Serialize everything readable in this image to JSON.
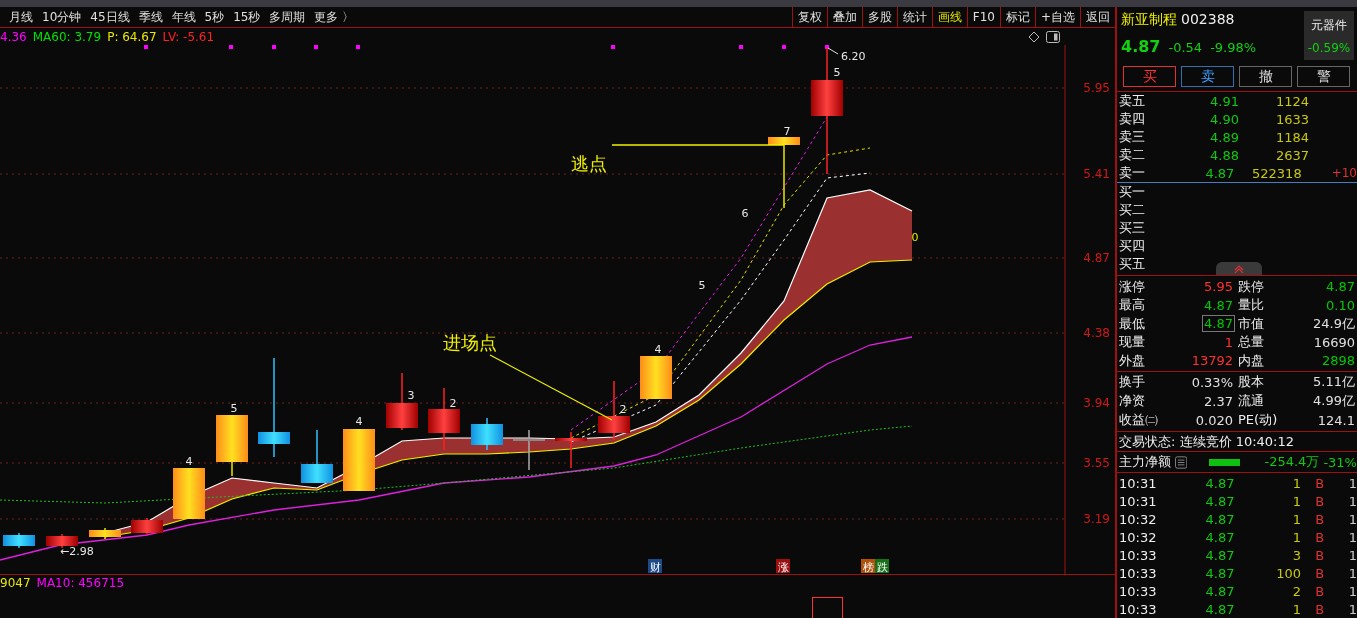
{
  "toolbar": {
    "periods": [
      {
        "label": "月线"
      },
      {
        "label": "10分钟"
      },
      {
        "label": "45日线"
      },
      {
        "label": "季线"
      },
      {
        "label": "年线"
      },
      {
        "label": "5秒"
      },
      {
        "label": "15秒"
      },
      {
        "label": "多周期"
      },
      {
        "label": "更多 〉"
      }
    ],
    "tools": [
      {
        "label": "复权",
        "selected": false
      },
      {
        "label": "叠加",
        "selected": false
      },
      {
        "label": "多股",
        "selected": false
      },
      {
        "label": "统计",
        "selected": false
      },
      {
        "label": "画线",
        "selected": true
      },
      {
        "label": "F10",
        "selected": false
      },
      {
        "label": "标记",
        "selected": false
      },
      {
        "label": "+自选",
        "selected": false
      },
      {
        "label": "返回",
        "selected": false
      }
    ]
  },
  "chart": {
    "indicators": [
      {
        "text": "4.36",
        "color": "#ff00ff"
      },
      {
        "text": "MA60: 3.79",
        "color": "#00e000"
      },
      {
        "text": "P: 64.67",
        "color": "#e8e800"
      },
      {
        "text": "LV: -5.61",
        "color": "#ff2020"
      }
    ],
    "price_labels": [
      "5.95",
      "5.41",
      "4.87",
      "4.38",
      "3.94",
      "3.55",
      "3.19"
    ],
    "candle_labels": [
      "4",
      "5",
      "4",
      "3",
      "2",
      "2",
      "4",
      "5",
      "6",
      "7",
      "5",
      "0"
    ],
    "high_label": "6.20",
    "low_label": "←2.98",
    "notes": [
      "逃点",
      "进场点"
    ],
    "events": [
      {
        "label": "财",
        "color": "#1e4a8a"
      },
      {
        "label": "涨",
        "color": "#9a1010"
      },
      {
        "label": "榜",
        "color": "#b0500a"
      },
      {
        "label": "跌",
        "color": "#187018"
      }
    ]
  },
  "volume_panel": {
    "indicators": [
      {
        "text": "9047",
        "color": "#e8e800"
      },
      {
        "text": "MA10: 456715",
        "color": "#ff00ff"
      }
    ]
  },
  "quote": {
    "name": "新亚制程",
    "code": "002388",
    "sector": "元器件",
    "sector_change": "-0.59%",
    "price": "4.87",
    "change": "-0.54",
    "change_pct": "-9.98%",
    "buttons": [
      {
        "label": "买",
        "kind": "buy"
      },
      {
        "label": "卖",
        "kind": "sell"
      },
      {
        "label": "撤",
        "kind": "cancel"
      },
      {
        "label": "警",
        "kind": "alert"
      }
    ],
    "asks": [
      {
        "label": "卖五",
        "price": "4.91",
        "volume": "1124"
      },
      {
        "label": "卖四",
        "price": "4.90",
        "volume": "1633"
      },
      {
        "label": "卖三",
        "price": "4.89",
        "volume": "1184"
      },
      {
        "label": "卖二",
        "price": "4.88",
        "volume": "2637"
      },
      {
        "label": "卖一",
        "price": "4.87",
        "volume": "522318",
        "delta": "+10"
      }
    ],
    "bids": [
      {
        "label": "买一"
      },
      {
        "label": "买二"
      },
      {
        "label": "买三"
      },
      {
        "label": "买四"
      },
      {
        "label": "买五"
      }
    ],
    "stats": [
      {
        "label": "涨停",
        "value": "5.95",
        "color": "#ff3030",
        "boxed": false
      },
      {
        "label": "跌停",
        "value": "4.87",
        "color": "#00c800",
        "boxed": false
      },
      {
        "label": "最高",
        "value": "4.87",
        "color": "#00c800",
        "boxed": false
      },
      {
        "label": "量比",
        "value": "0.10",
        "color": "#00c800",
        "boxed": false
      },
      {
        "label": "最低",
        "value": "4.87",
        "color": "#00c800",
        "boxed": true
      },
      {
        "label": "市值",
        "value": "24.9亿",
        "color": "#e0e0e0",
        "boxed": false
      },
      {
        "label": "现量",
        "value": "1",
        "color": "#ff3030",
        "boxed": false
      },
      {
        "label": "总量",
        "value": "16690",
        "color": "#e0e0e0",
        "boxed": false
      },
      {
        "label": "外盘",
        "value": "13792",
        "color": "#ff3030",
        "boxed": false
      },
      {
        "label": "内盘",
        "value": "2898",
        "color": "#00c800",
        "boxed": false
      }
    ],
    "fundamentals": [
      {
        "label": "换手",
        "value": "0.33%"
      },
      {
        "label": "股本",
        "value": "5.11亿"
      },
      {
        "label": "净资",
        "value": "2.37"
      },
      {
        "label": "流通",
        "value": "4.99亿"
      },
      {
        "label": "收益㈡",
        "value": "0.020"
      },
      {
        "label": "PE(动)",
        "value": "124.1"
      }
    ],
    "status": "交易状态: 连续竞价 10:40:12",
    "main_flow": {
      "label": "主力净额",
      "amount": "-254.4万",
      "percent": "-31%"
    },
    "trades": [
      {
        "time": "10:31",
        "price": "4.87",
        "volume": "1",
        "side": "B",
        "column_5": "1"
      },
      {
        "time": "10:31",
        "price": "4.87",
        "volume": "1",
        "side": "B",
        "column_5": "1"
      },
      {
        "time": "10:32",
        "price": "4.87",
        "volume": "1",
        "side": "B",
        "column_5": "1"
      },
      {
        "time": "10:32",
        "price": "4.87",
        "volume": "1",
        "side": "B",
        "column_5": "1"
      },
      {
        "time": "10:33",
        "price": "4.87",
        "volume": "3",
        "side": "B",
        "column_5": "1"
      },
      {
        "time": "10:33",
        "price": "4.87",
        "volume": "100",
        "side": "B",
        "column_5": "1"
      },
      {
        "time": "10:33",
        "price": "4.87",
        "volume": "2",
        "side": "B",
        "column_5": "1"
      },
      {
        "time": "10:33",
        "price": "4.87",
        "volume": "1",
        "side": "B",
        "column_5": "1"
      }
    ]
  }
}
